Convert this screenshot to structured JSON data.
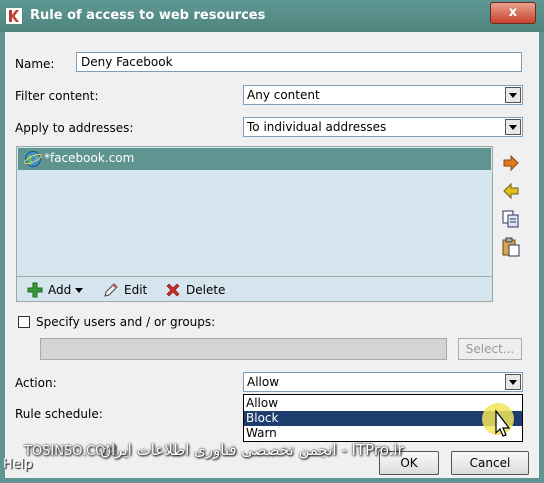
{
  "window": {
    "title": "Rule of access to web resources",
    "close_label": "x"
  },
  "form": {
    "name_label": "Name:",
    "name_value": "Deny Facebook",
    "filter_label": "Filter content:",
    "filter_value": "Any content",
    "apply_label": "Apply to addresses:",
    "apply_value": "To individual addresses"
  },
  "address_list": {
    "items": [
      "*facebook.com"
    ]
  },
  "list_toolbar": {
    "add_label": "Add",
    "edit_label": "Edit",
    "delete_label": "Delete"
  },
  "users": {
    "checkbox_label": "Specify users and / or groups:",
    "select_label": "Select..."
  },
  "action": {
    "label": "Action:",
    "value": "Allow",
    "options": [
      "Allow",
      "Block",
      "Warn"
    ],
    "selected_index": 1
  },
  "schedule": {
    "label": "Rule schedule:"
  },
  "buttons": {
    "ok_label": "OK",
    "cancel_label": "Cancel",
    "help_label": "Help"
  },
  "watermark": {
    "left": "TOSINSO.COM",
    "right": "ITPro.ir - انجمن تخصصی فناوری اطلاعات ایران"
  },
  "colors": {
    "titlebar": "#5f9590",
    "selection": "#1d3d6e",
    "list_background": "#d6e4ed"
  }
}
